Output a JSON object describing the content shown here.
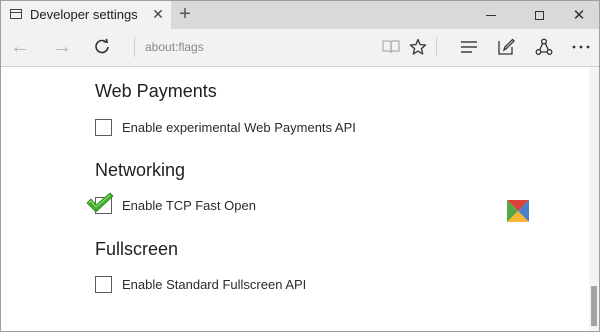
{
  "tab": {
    "title": "Developer settings"
  },
  "toolbar": {
    "address": "about:flags"
  },
  "sections": [
    {
      "title": "Web Payments",
      "flag_label": "Enable experimental Web Payments API",
      "checked": false
    },
    {
      "title": "Networking",
      "flag_label": "Enable TCP Fast Open",
      "checked": true
    },
    {
      "title": "Fullscreen",
      "flag_label": "Enable Standard Fullscreen API",
      "checked": false
    }
  ],
  "icons": [
    "tab-page-icon",
    "tab-close-icon",
    "new-tab-icon",
    "minimize-icon",
    "maximize-icon",
    "close-icon",
    "back-arrow-icon",
    "forward-arrow-icon",
    "refresh-icon",
    "reading-view-icon",
    "favorite-star-icon",
    "hub-icon",
    "web-note-icon",
    "share-icon",
    "more-icon",
    "green-checkmark-icon",
    "colorful-logo-icon"
  ],
  "colors": {
    "check_green": "#3fae2a",
    "tab_bar": "#d9d9d9",
    "toolbar": "#f2f2f2"
  }
}
